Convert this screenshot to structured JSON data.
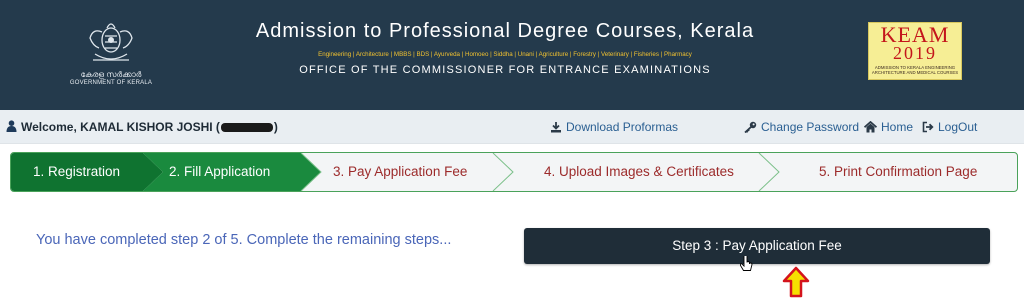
{
  "header": {
    "emblem_text_malayalam": "കേരള സർക്കാർ",
    "emblem_text_english": "GOVERNMENT OF KERALA",
    "title": "Admission to Professional Degree Courses, Kerala",
    "subtitle": "Engineering | Architecture | MBBS | BDS | Ayurveda | Homoeo | Siddha | Unani | Agriculture | Forestry | Veterinary | Fisheries | Pharmacy",
    "office": "OFFICE OF THE COMMISSIONER FOR ENTRANCE EXAMINATIONS",
    "logo": {
      "line1": "KEAM",
      "line2": "2019",
      "line3": "ADMISSION TO KERALA ENGINEERING",
      "line4": "ARCHITECTURE AND MEDICAL COURSES"
    }
  },
  "toolbar": {
    "welcome_prefix": "Welcome, KAMAL KISHOR JOSHI (",
    "welcome_suffix": ")",
    "download_label": "Download Proformas",
    "change_password_label": "Change Password",
    "home_label": "Home",
    "logout_label": "LogOut"
  },
  "steps": [
    {
      "label": "1. Registration",
      "status": "done"
    },
    {
      "label": "2. Fill Application",
      "status": "done"
    },
    {
      "label": "3. Pay Application Fee",
      "status": "pending"
    },
    {
      "label": "4. Upload Images & Certificates",
      "status": "pending"
    },
    {
      "label": "5. Print Confirmation Page",
      "status": "pending"
    }
  ],
  "main": {
    "progress_message": "You have completed step 2 of 5. Complete the remaining steps...",
    "next_step_button": "Step 3 : Pay Application Fee"
  },
  "colors": {
    "header_bg": "#243a4c",
    "step_done": "#0f7330",
    "step_done_alt": "#1a8a3e",
    "step_pending_text": "#9c2b2b",
    "button_bg": "#1f2d38",
    "arrow_fill": "#f6e000",
    "arrow_stroke": "#d4141c"
  },
  "icons": [
    "emblem-icon",
    "user-icon",
    "download-icon",
    "key-icon",
    "home-icon",
    "logout-icon",
    "pointer-cursor-icon",
    "up-arrow-icon"
  ]
}
